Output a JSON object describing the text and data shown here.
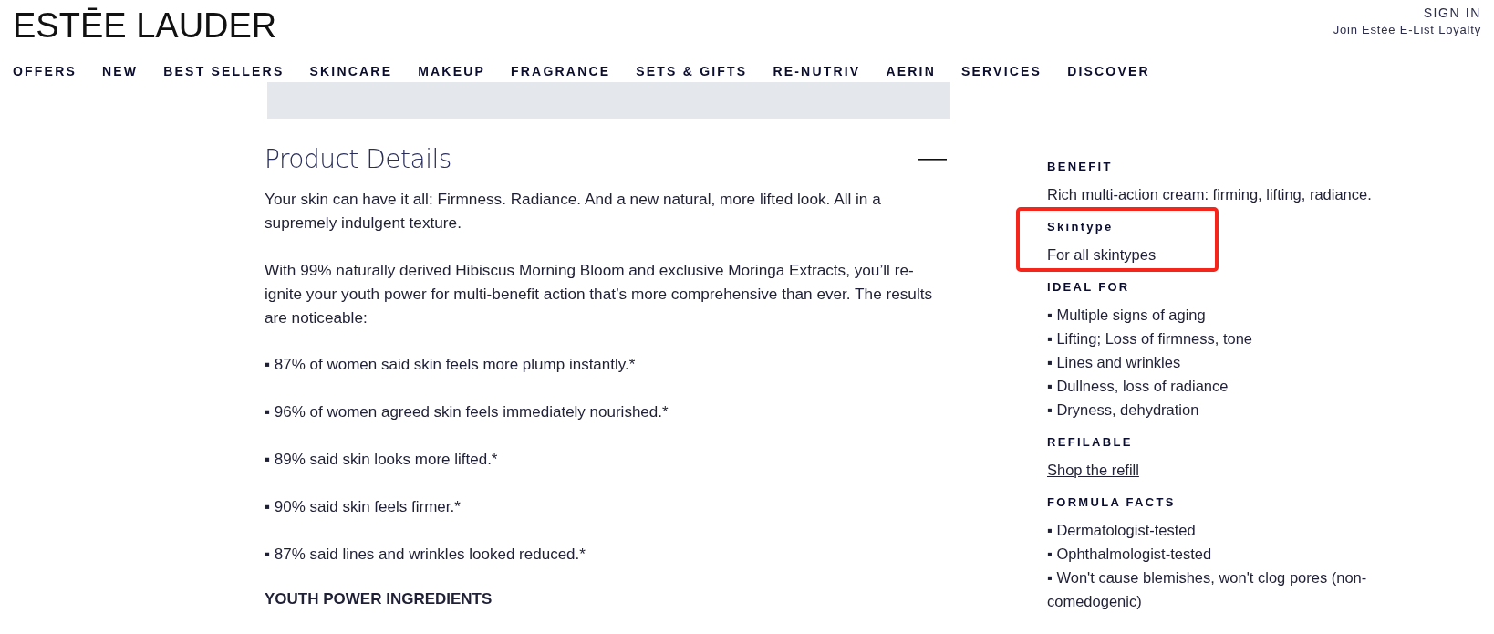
{
  "header": {
    "logo": "ESTĒE LAUDER",
    "account_links": [
      {
        "label": "SIGN IN"
      },
      {
        "label": "Join Estée E-List Loyalty"
      }
    ]
  },
  "nav": [
    "OFFERS",
    "NEW",
    "BEST SELLERS",
    "SKINCARE",
    "MAKEUP",
    "FRAGRANCE",
    "SETS & GIFTS",
    "RE-NUTRIV",
    "AERIN",
    "SERVICES",
    "DISCOVER"
  ],
  "product_details": {
    "title": "Product Details",
    "expanded": true,
    "paragraphs": [
      "Your skin can have it all: Firmness. Radiance. And a new natural, more lifted look. All in a supremely indulgent texture.",
      "With 99% naturally derived Hibiscus Morning Bloom and exclusive Moringa Extracts, you’ll re-ignite your youth power for multi-benefit action that’s more comprehensive than ever. The results are noticeable:"
    ],
    "results": [
      "▪ 87% of women said skin feels more plump instantly.*",
      "▪ 96% of women agreed skin feels immediately nourished.*",
      "▪ 89% said skin looks more lifted.*",
      "▪ 90% said skin feels firmer.*",
      "▪ 87% said lines and wrinkles looked reduced.*"
    ],
    "subheading": "YOUTH POWER INGREDIENTS"
  },
  "attributes": [
    {
      "kind": "text",
      "heading": "BENEFIT",
      "highlighted": false,
      "text": "Rich multi-action cream: firming, lifting, radiance."
    },
    {
      "kind": "text",
      "heading": "Skintype",
      "highlighted": true,
      "text": "For all skintypes"
    },
    {
      "kind": "list",
      "heading": "IDEAL FOR",
      "highlighted": false,
      "items": [
        "▪ Multiple signs of aging",
        "▪ Lifting; Loss of firmness, tone",
        "▪ Lines and wrinkles",
        "▪ Dullness, loss of radiance",
        "▪ Dryness, dehydration"
      ]
    },
    {
      "kind": "link",
      "heading": "REFILABLE",
      "highlighted": false,
      "text": "Shop the refill"
    },
    {
      "kind": "list",
      "heading": "FORMULA FACTS",
      "highlighted": false,
      "items": [
        "▪ Dermatologist-tested",
        "▪ Ophthalmologist-tested",
        "▪ Won't cause blemishes, won't clog pores (non-comedogenic)"
      ]
    }
  ]
}
